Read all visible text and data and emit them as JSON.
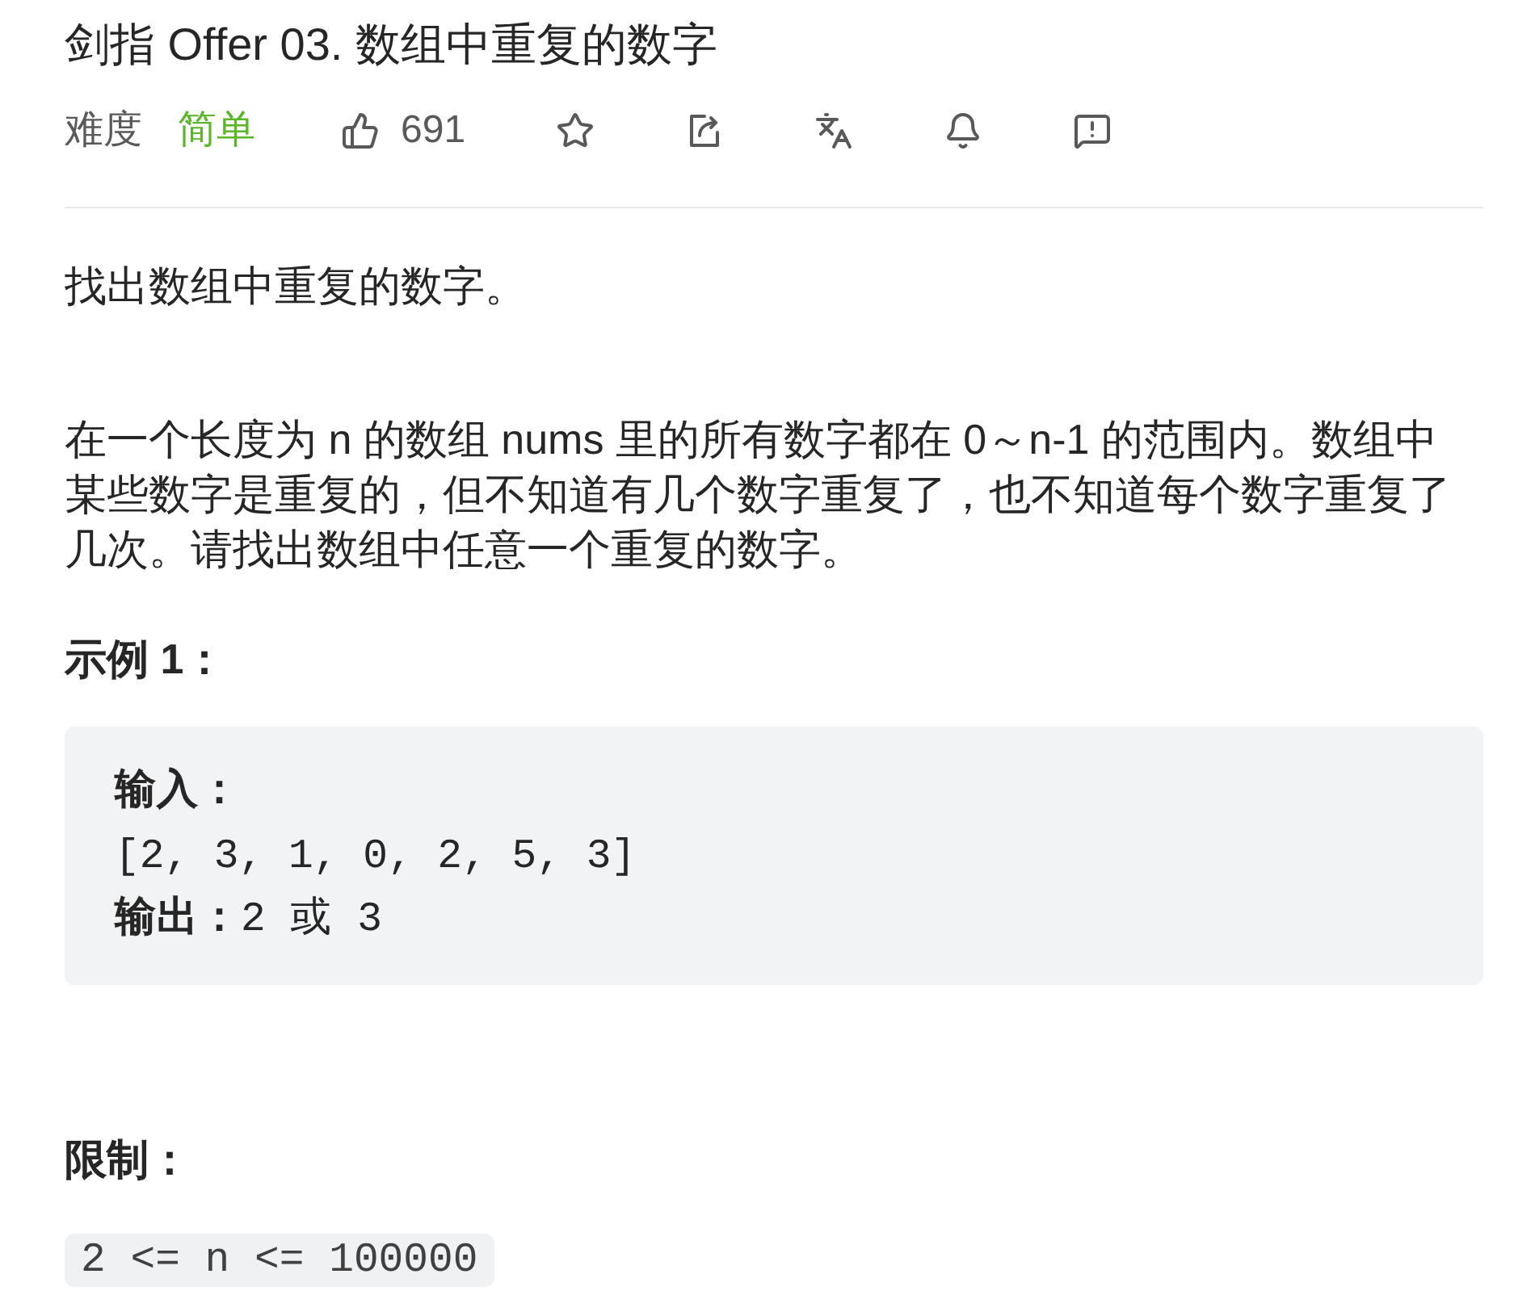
{
  "title": "剑指 Offer 03. 数组中重复的数字",
  "meta": {
    "difficulty_label": "难度",
    "difficulty": "简单",
    "likes": "691"
  },
  "description": [
    "找出数组中重复的数字。",
    "在一个长度为 n 的数组 nums 里的所有数字都在 0～n-1 的范围内。数组中某些数字是重复的，但不知道有几个数字重复了，也不知道每个数字重复了几次。请找出数组中任意一个重复的数字。"
  ],
  "example": {
    "heading": "示例 1：",
    "input_label": "输入：",
    "input": "[2, 3, 1, 0, 2, 5, 3]",
    "output": "**输出：**2 或 3"
  },
  "constraints": {
    "heading": "限制：",
    "items": [
      "2 <= n <= 100000"
    ]
  }
}
